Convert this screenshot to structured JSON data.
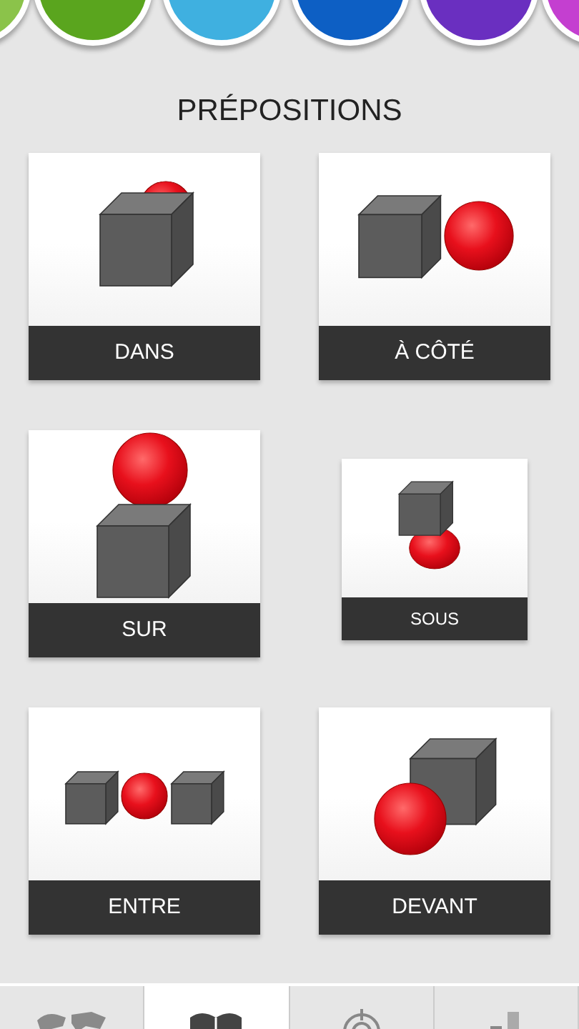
{
  "categories": [
    {
      "color": "#8bc34a"
    },
    {
      "color": "#5aa51e"
    },
    {
      "color": "#3fb0e0"
    },
    {
      "color": "#0d5fc4"
    },
    {
      "color": "#6a2fc0"
    },
    {
      "color": "#c43fd0"
    }
  ],
  "heading": "PRÉPOSITIONS",
  "cards": [
    {
      "kind": "dans",
      "label": "DANS",
      "pressed": false
    },
    {
      "kind": "a_cote",
      "label": "À CÔTÉ",
      "pressed": false
    },
    {
      "kind": "sur",
      "label": "SUR",
      "pressed": false
    },
    {
      "kind": "sous",
      "label": "SOUS",
      "pressed": true
    },
    {
      "kind": "entre",
      "label": "ENTRE",
      "pressed": false
    },
    {
      "kind": "devant",
      "label": "DEVANT",
      "pressed": false
    }
  ],
  "bottom_tabs": [
    {
      "kind": "map",
      "selected": false
    },
    {
      "kind": "book",
      "selected": true
    },
    {
      "kind": "target",
      "selected": false
    },
    {
      "kind": "chart",
      "selected": false
    }
  ]
}
